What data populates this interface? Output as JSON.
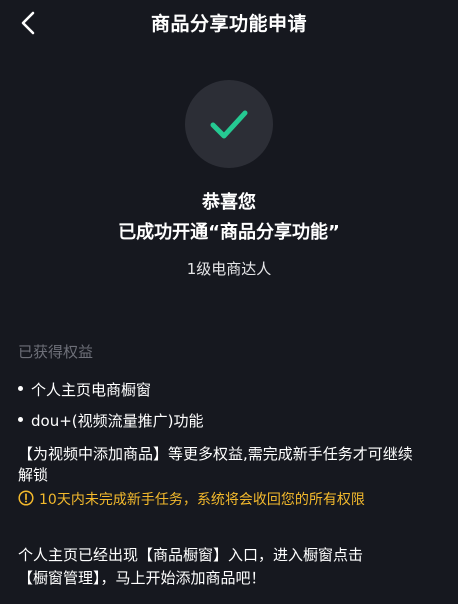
{
  "header": {
    "title": "商品分享功能申请",
    "back_icon": "chevron-left-icon"
  },
  "success": {
    "icon": "checkmark-icon",
    "circle_color": "#2c2e36",
    "check_color": "#25c992",
    "congrats": "恭喜您",
    "opened": "已成功开通“商品分享功能”",
    "level": "1级电商达人"
  },
  "benefits": {
    "label": "已获得权益",
    "items": [
      {
        "label": "个人主页电商橱窗"
      },
      {
        "label": "dou+(视频流量推广)功能"
      }
    ]
  },
  "note": {
    "line1": "【为视频中添加商品】等更多权益,需完成新手任务才可继续",
    "line2": "解锁"
  },
  "warning": {
    "icon": "warning-circle-icon",
    "text": "10天内未完成新手任务，系统将会收回您的所有权限",
    "color": "#f3b92c"
  },
  "instruction": {
    "line1": "个人主页已经出现【商品橱窗】入口，进入橱窗点击",
    "line2": "【橱窗管理】，马上开始添加商品吧！"
  }
}
